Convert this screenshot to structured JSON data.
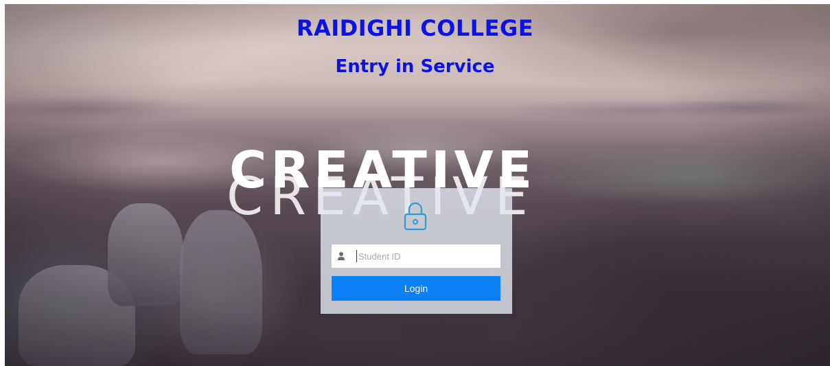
{
  "header": {
    "title": "RAIDIGHI COLLEGE",
    "subtitle": "Entry in Service"
  },
  "background": {
    "overlay_text_bold": "CREATIVE",
    "overlay_text_thin": "CREATIVE"
  },
  "login": {
    "student_id_placeholder": "Student ID",
    "student_id_value": "",
    "login_label": "Login",
    "lock_icon": "lock-icon",
    "user_icon": "user-icon"
  },
  "colors": {
    "title": "#0a12e8",
    "button": "#0b80f7",
    "lock": "#2a9bd8"
  }
}
